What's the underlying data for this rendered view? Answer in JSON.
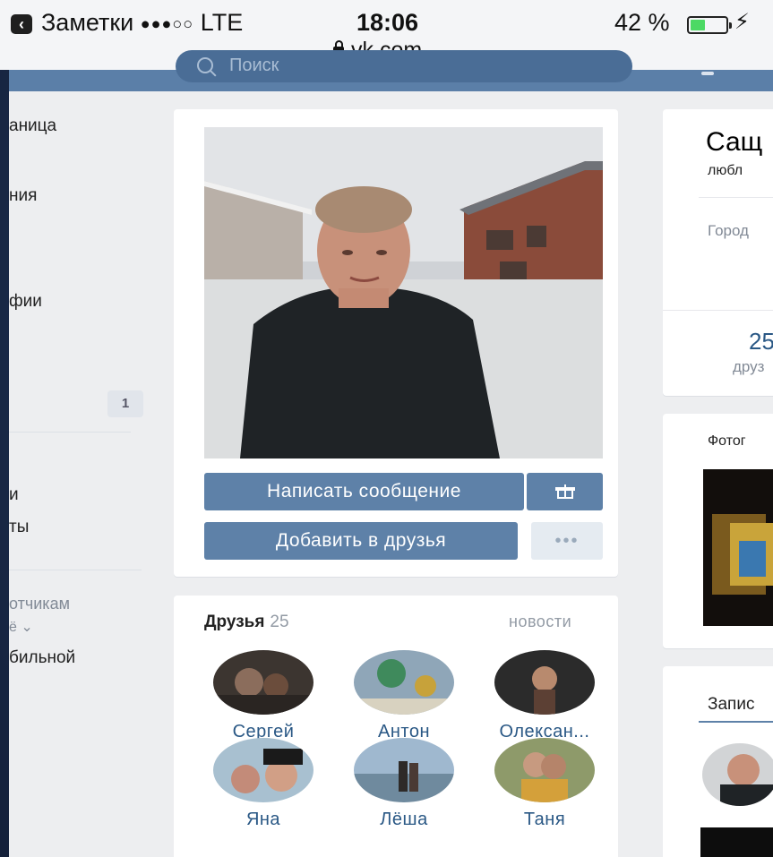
{
  "status_bar": {
    "back_app": "Заметки",
    "signal": "●●●○○",
    "network": "LTE",
    "time": "18:06",
    "url": "vk.com",
    "battery": "42 %",
    "battery_level": 0.42
  },
  "header": {
    "search_placeholder": "Поиск"
  },
  "sidebar": {
    "items": [
      "аница",
      "ния",
      "фии",
      "и",
      "ты"
    ],
    "counter": "1",
    "footer": [
      "отчикам",
      "ё ⌄",
      "бильной"
    ]
  },
  "profile": {
    "message_button": "Написать сообщение",
    "add_friend_button": "Добавить в друзья",
    "more_button": "•••"
  },
  "friends": {
    "title": "Друзья",
    "count": "25",
    "news_link": "новости",
    "list": [
      {
        "name": "Сергей"
      },
      {
        "name": "Антон"
      },
      {
        "name": "Олексан..."
      },
      {
        "name": "Яна"
      },
      {
        "name": "Лёша"
      },
      {
        "name": "Таня"
      }
    ]
  },
  "info": {
    "name": "Сащ",
    "status": "любл",
    "city_label": "Город",
    "friends_count": "25",
    "friends_label": "друз"
  },
  "photos": {
    "title": "Фотог"
  },
  "wall": {
    "tab_title": "Запис"
  },
  "colors": {
    "accent": "#5e81a8",
    "link": "#2a5885",
    "header": "#5b7fa8",
    "page_bg": "#edeef0"
  }
}
